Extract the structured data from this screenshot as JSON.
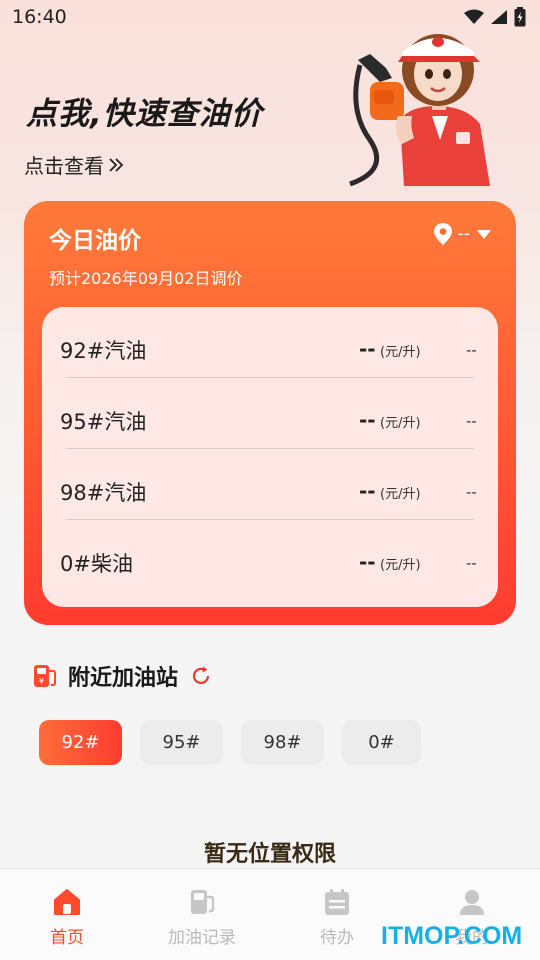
{
  "status_bar": {
    "time": "16:40"
  },
  "hero": {
    "title": "点我,快速查油价",
    "link_text": "点击查看"
  },
  "price_card": {
    "title": "今日油价",
    "location_value": "--",
    "adjust_note": "预计2026年09月02日调价",
    "rows": [
      {
        "name": "92#汽油",
        "price": "--",
        "unit": "(元/升)",
        "change": "--"
      },
      {
        "name": "95#汽油",
        "price": "--",
        "unit": "(元/升)",
        "change": "--"
      },
      {
        "name": "98#汽油",
        "price": "--",
        "unit": "(元/升)",
        "change": "--"
      },
      {
        "name": "0#柴油",
        "price": "--",
        "unit": "(元/升)",
        "change": "--"
      }
    ]
  },
  "nearby": {
    "title": "附近加油站",
    "chips": [
      "92#",
      "95#",
      "98#",
      "0#"
    ],
    "selected_chip": "92#",
    "empty_text": "暂无位置权限"
  },
  "bottom_nav": {
    "items": [
      {
        "label": "首页",
        "icon": "home-icon",
        "active": true
      },
      {
        "label": "加油记录",
        "icon": "fuel-pump-icon",
        "active": false
      },
      {
        "label": "待办",
        "icon": "calendar-icon",
        "active": false
      },
      {
        "label": "我的",
        "icon": "user-icon",
        "active": false
      }
    ]
  },
  "watermark": "ITMOP.COM",
  "colors": {
    "accent": "#ff4a2e",
    "card_gradient_top": "#ff7a3a",
    "card_gradient_bottom": "#ff3b2f",
    "inactive": "#b9b9b9"
  }
}
